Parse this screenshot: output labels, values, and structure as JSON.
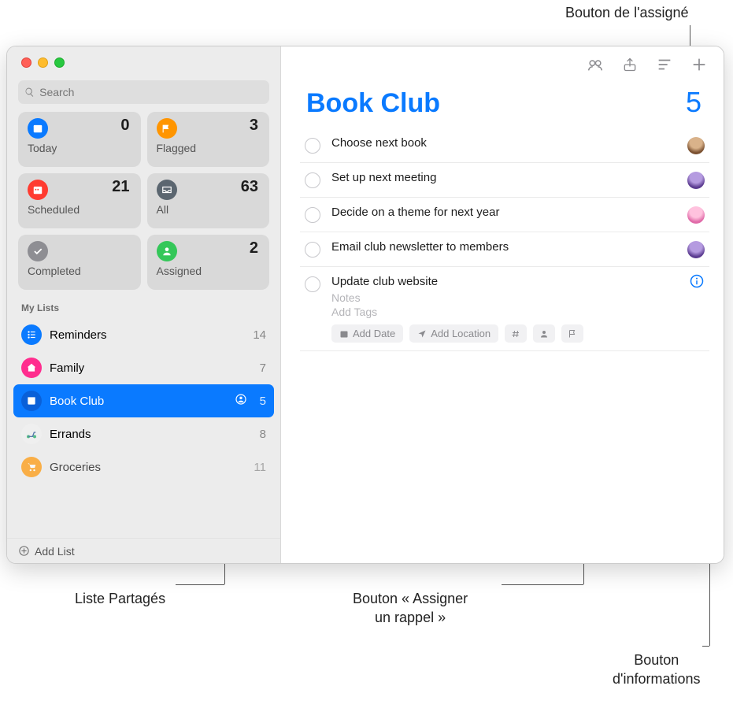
{
  "callouts": {
    "assignee_button": "Bouton de l'assigné",
    "shared_list": "Liste Partagés",
    "assign_reminder": "Bouton « Assigner\nun rappel »",
    "info_button": "Bouton\nd'informations"
  },
  "search": {
    "placeholder": "Search"
  },
  "smart": {
    "today": {
      "label": "Today",
      "count": "0"
    },
    "flagged": {
      "label": "Flagged",
      "count": "3"
    },
    "scheduled": {
      "label": "Scheduled",
      "count": "21"
    },
    "all": {
      "label": "All",
      "count": "63"
    },
    "completed": {
      "label": "Completed",
      "count": ""
    },
    "assigned": {
      "label": "Assigned",
      "count": "2"
    }
  },
  "sections": {
    "my_lists": "My Lists"
  },
  "lists": {
    "reminders": {
      "name": "Reminders",
      "count": "14"
    },
    "family": {
      "name": "Family",
      "count": "7"
    },
    "bookclub": {
      "name": "Book Club",
      "count": "5"
    },
    "errands": {
      "name": "Errands",
      "count": "8"
    },
    "groceries": {
      "name": "Groceries",
      "count": "11"
    }
  },
  "add_list": "Add List",
  "main": {
    "title": "Book Club",
    "total": "5"
  },
  "reminders": {
    "r1": "Choose next book",
    "r2": "Set up next meeting",
    "r3": "Decide on a theme for next year",
    "r4": "Email club newsletter to members",
    "r5": "Update club website",
    "notes_ph": "Notes",
    "tags_ph": "Add Tags",
    "add_date": "Add Date",
    "add_location": "Add Location"
  },
  "colors": {
    "today": "#0a7aff",
    "flagged": "#ff9500",
    "scheduled": "#ff3b30",
    "all": "#5b6670",
    "completed": "#8e8e93",
    "assigned": "#34c759",
    "reminders_icon": "#0a7aff",
    "family_icon": "#ff2d8e",
    "bookclub_icon": "#0a7aff",
    "errands_icon": "#efefef",
    "groceries_icon": "#ff9500"
  },
  "assignees": {
    "a1": "#b48b72",
    "a2": "#7a5bb0",
    "a3": "#e99ac1",
    "a4": "#7a5bb0"
  }
}
